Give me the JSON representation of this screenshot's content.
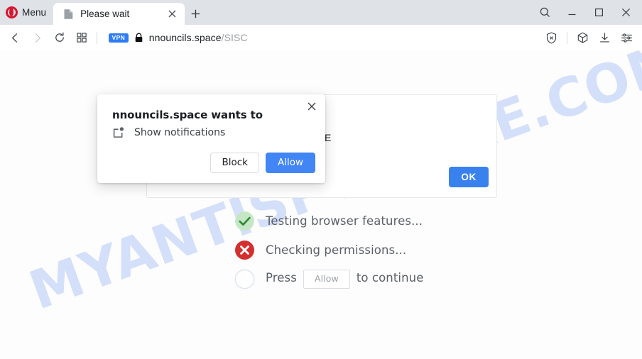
{
  "browser": {
    "name": "opera",
    "menu_label": "Menu",
    "menu_icon": "opera-logo-icon",
    "tabs": [
      {
        "title": "Please wait",
        "favicon": "page-favicon",
        "close_icon": "close-icon",
        "active": true
      }
    ],
    "new_tab_icon": "plus-icon",
    "window_controls": [
      {
        "name": "search-icon",
        "glyph": "search"
      },
      {
        "name": "minimize-icon",
        "glyph": "minimize"
      },
      {
        "name": "maximize-icon",
        "glyph": "maximize"
      },
      {
        "name": "close-window-icon",
        "glyph": "close"
      }
    ],
    "toolbar": {
      "back_icon": "back-arrow-icon",
      "forward_icon": "forward-arrow-icon",
      "reload_icon": "reload-icon",
      "tab_grid_icon": "tab-grid-icon",
      "vpn_badge": "VPN",
      "lock_icon": "lock-icon",
      "url_domain": "nnouncils.space",
      "url_path": "/SISC",
      "right_icons": [
        {
          "name": "ad-blocker-icon",
          "glyph": "shield-x"
        },
        {
          "name": "extensions-cube-icon",
          "glyph": "cube"
        },
        {
          "name": "downloads-icon",
          "glyph": "download"
        },
        {
          "name": "easy-setup-icon",
          "glyph": "sliders"
        }
      ]
    }
  },
  "page": {
    "watermark": "MYANTISPYWARE.COM",
    "card": {
      "partial_text": "E",
      "ok_label": "OK"
    },
    "checklist": [
      {
        "status": "success",
        "icon": "check-circle-icon",
        "text": "Testing browser features..."
      },
      {
        "status": "error",
        "icon": "error-circle-icon",
        "text": "Checking permissions..."
      },
      {
        "status": "pending",
        "icon": "empty-circle-icon",
        "text_before": "Press",
        "inline_button": "Allow",
        "text_after": "to continue"
      }
    ]
  },
  "permission_dialog": {
    "title": "nnouncils.space wants to",
    "permission_icon": "notification-icon",
    "permission_label": "Show notifications",
    "close_icon": "close-icon",
    "block_label": "Block",
    "allow_label": "Allow"
  },
  "colors": {
    "accent_blue": "#4285f4",
    "ok_blue": "#3a81f0",
    "vpn_blue": "#2e7cf6",
    "opera_red": "#d8152f",
    "success_green": "#34a853",
    "error_red": "#d93025",
    "watermark_blue": "#d4e0fa",
    "tabstrip_bg": "#dfe3e8"
  }
}
